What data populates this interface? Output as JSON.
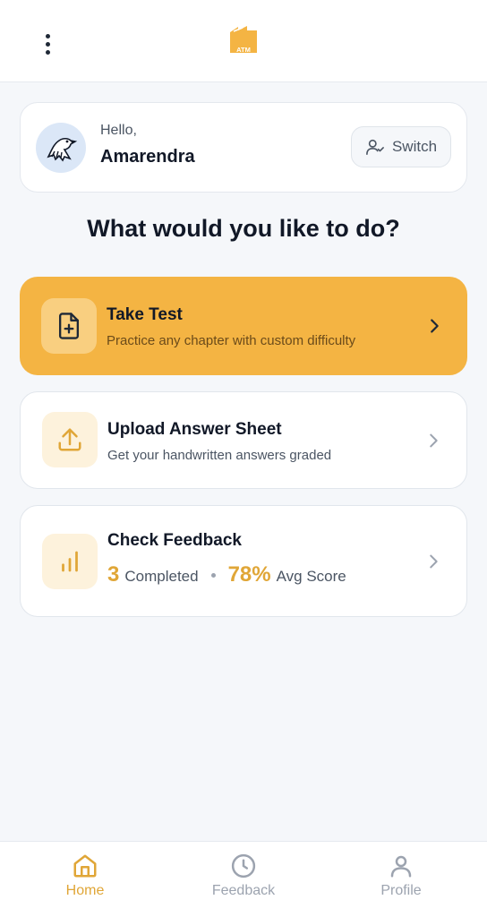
{
  "header": {
    "logo_text": "ATM",
    "menu_icon": "more-vertical-icon"
  },
  "profile": {
    "greeting": "Hello,",
    "name": "Amarendra",
    "switch_label": "Switch"
  },
  "heading": "What would you like to do?",
  "cards": {
    "take_test": {
      "title": "Take Test",
      "subtitle": "Practice any chapter with custom difficulty"
    },
    "upload": {
      "title": "Upload Answer Sheet",
      "subtitle": "Get your handwritten answers graded"
    },
    "feedback": {
      "title": "Check Feedback",
      "completed_count": "3",
      "completed_label": "Completed",
      "avg_score": "78%",
      "avg_label": "Avg Score"
    }
  },
  "nav": {
    "home": "Home",
    "feedback": "Feedback",
    "profile": "Profile"
  },
  "colors": {
    "accent": "#f4b443",
    "accent_text": "#e0a637",
    "background": "#f5f7fa"
  }
}
